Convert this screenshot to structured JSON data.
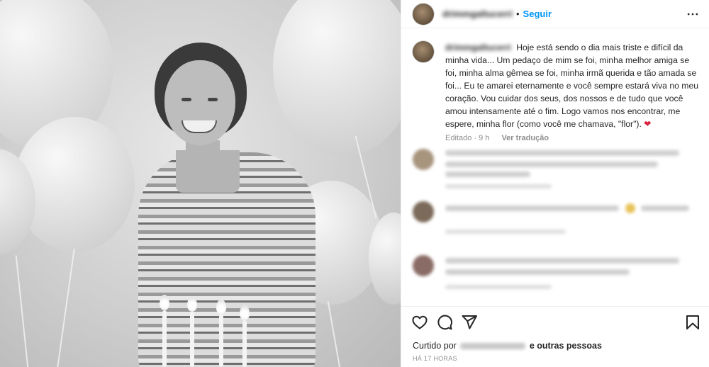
{
  "post": {
    "author": "drimmgaltucerri",
    "follow_label": "Seguir",
    "separator": "•"
  },
  "caption": {
    "author": "drimmgaltucerri",
    "text": "Hoje está sendo o dia mais triste e difícil da minha vida... Um pedaço de mim se foi, minha melhor amiga se foi, minha alma gêmea se foi, minha irmã querida e tão amada se foi... Eu te amarei eternamente e você sempre estará viva no meu coração. Vou cuidar dos seus, dos nossos e de tudo que você amou intensamente até o fim. Logo vamos nos encontrar, me espere, minha flor (como você me chamava, \"flor\").",
    "heart": "❤",
    "edited": "Editado · 9 h",
    "translate_label": "Ver tradução"
  },
  "likes": {
    "prefix": "Curtido por",
    "liker": " ",
    "others": "e outras pessoas"
  },
  "timestamp": "HÁ 17 HORAS",
  "icons": {
    "more": "more-horizontal-icon",
    "like": "heart-icon",
    "comment": "comment-icon",
    "share": "send-icon",
    "save": "bookmark-icon"
  },
  "colors": {
    "accent": "#0095f6",
    "text": "#262626",
    "muted": "#8e8e8e",
    "heart": "#d8213d"
  }
}
